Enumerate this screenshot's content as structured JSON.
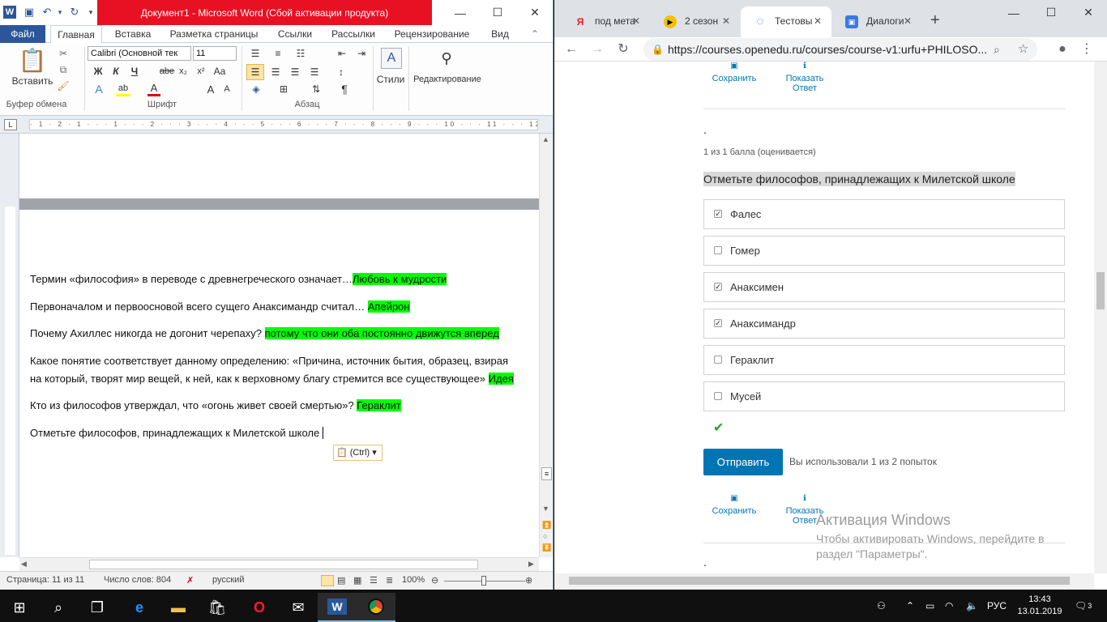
{
  "word": {
    "title": "Документ1  -  Microsoft Word (Сбой активации продукта)",
    "tabs": [
      "Файл",
      "Главная",
      "Вставка",
      "Разметка страницы",
      "Ссылки",
      "Рассылки",
      "Рецензирование",
      "Вид"
    ],
    "ribbon": {
      "paste_label": "Вставить",
      "clipboard_group": "Буфер обмена",
      "font_group": "Шрифт",
      "paragraph_group": "Абзац",
      "font_name": "Calibri (Основной тек",
      "font_size": "11",
      "bold": "Ж",
      "italic": "К",
      "underline": "Ч",
      "strike": "abe",
      "styles_label": "Стили",
      "editing_label": "Редактирование"
    },
    "ruler_marks": "· 1 · 2 · 1 · · · 1 · · · 2 · · · 3 · · · 4 · · · 5 · · · 6 · · · 7 · · · 8 · · · 9 · · · 10 · · · 11 · · · 12 · · · 13 · · · 14 · · · 15 · · · 16 ·",
    "document": {
      "q1": "Термин «философия» в переводе с древнегреческого означает…",
      "a1": "Любовь к мудрости",
      "q2": "Первоначалом и первоосновой всего сущего Анаксимандр считал…",
      "a2": "Апейрон",
      "q3": "Почему Ахиллес никогда не догонит черепаху?",
      "a3": "потому что они оба постоянно движутся вперед",
      "q4_line1": "Какое понятие соответствует данному определению: «Причина, источник бытия, образец, взирая",
      "q4_line2": "на который, творят мир вещей, к ней, как к верховному благу стремится все существующее»",
      "a4": "Идея",
      "q5": "Кто из философов утверждал, что «огонь живет своей смертью»?",
      "a5": "Гераклит",
      "q6": "Отметьте философов, принадлежащих к Милетской школе",
      "paste_tag": "(Ctrl)"
    },
    "status": {
      "page": "Страница: 11 из 11",
      "words": "Число слов: 804",
      "language": "русский",
      "zoom": "100%"
    }
  },
  "browser": {
    "tabs": [
      {
        "title": "под мета",
        "favicon": "Я",
        "color": "#e31e24"
      },
      {
        "title": "2 сезон",
        "favicon": "▶",
        "color": "#f2c200"
      },
      {
        "title": "Тестовы",
        "favicon": "◌",
        "color": "#1a73e8"
      },
      {
        "title": "Диалоги",
        "favicon": "▣",
        "color": "#3b78e7"
      }
    ],
    "url": "https://courses.openedu.ru/courses/course-v1:urfu+PHILOSO...",
    "url_host": "https://courses.openedu.ru",
    "page": {
      "save_label": "Сохранить",
      "show_answer_l1": "Показать",
      "show_answer_l2": "Ответ",
      "dot": ".",
      "score": "1 из 1 балла (оценивается)",
      "question": "Отметьте философов, принадлежащих к Милетской школе",
      "options": [
        {
          "label": "Фалес",
          "checked": true
        },
        {
          "label": "Гомер",
          "checked": false
        },
        {
          "label": "Анаксимен",
          "checked": true
        },
        {
          "label": "Анаксимандр",
          "checked": true
        },
        {
          "label": "Гераклит",
          "checked": false
        },
        {
          "label": "Мусей",
          "checked": false
        }
      ],
      "correct_mark": "✔",
      "submit_label": "Отправить",
      "attempts": "Вы использовали 1 из 2 попыток",
      "dot2": "."
    },
    "watermark": {
      "title": "Активация Windows",
      "line1": "Чтобы активировать Windows, перейдите в",
      "line2": "раздел \"Параметры\"."
    }
  },
  "taskbar": {
    "language": "РУС",
    "time": "13:43",
    "date": "13.01.2019",
    "notifications": "3"
  },
  "colors": {
    "word_blue": "#2b579a",
    "title_red": "#e81123",
    "highlight_green": "#00ff00",
    "edx_blue": "#0075b4",
    "check_green": "#2e9d2e"
  }
}
